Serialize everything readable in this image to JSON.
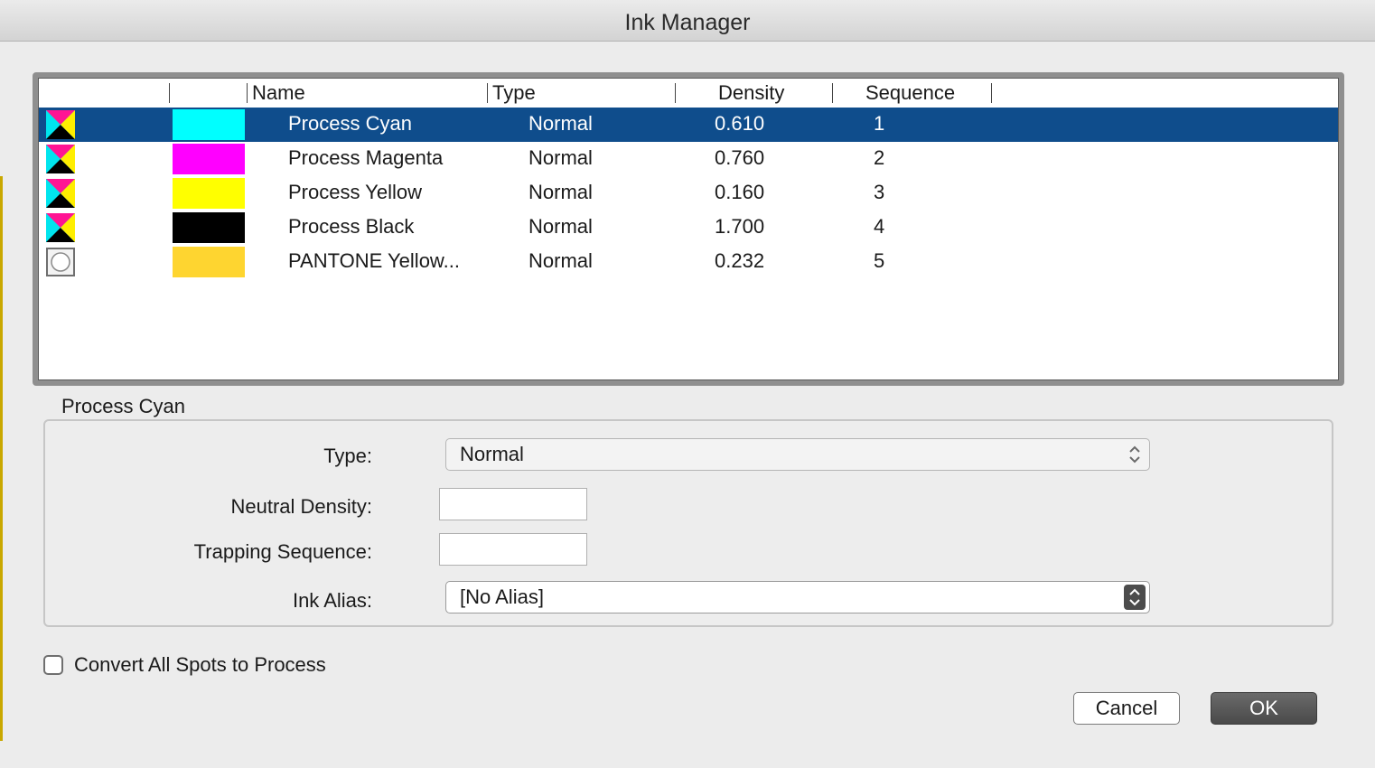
{
  "window": {
    "title": "Ink Manager"
  },
  "list": {
    "columns": {
      "name": "Name",
      "type": "Type",
      "density": "Density",
      "sequence": "Sequence"
    },
    "rows": [
      {
        "icon": "process-ink-icon",
        "swatch_color": "#00ffff",
        "name": "Process Cyan",
        "type": "Normal",
        "density": "0.610",
        "sequence": "1",
        "selected": true
      },
      {
        "icon": "process-ink-icon",
        "swatch_color": "#ff00ff",
        "name": "Process Magenta",
        "type": "Normal",
        "density": "0.760",
        "sequence": "2",
        "selected": false
      },
      {
        "icon": "process-ink-icon",
        "swatch_color": "#ffff00",
        "name": "Process Yellow",
        "type": "Normal",
        "density": "0.160",
        "sequence": "3",
        "selected": false
      },
      {
        "icon": "process-ink-icon",
        "swatch_color": "#000000",
        "name": "Process Black",
        "type": "Normal",
        "density": "1.700",
        "sequence": "4",
        "selected": false
      },
      {
        "icon": "spot-ink-icon",
        "swatch_color": "#fed530",
        "name": "PANTONE Yellow...",
        "type": "Normal",
        "density": "0.232",
        "sequence": "5",
        "selected": false
      }
    ]
  },
  "details": {
    "group_title": "Process Cyan",
    "type_label": "Type:",
    "type_value": "Normal",
    "neutral_density_label": "Neutral Density:",
    "neutral_density_value": "",
    "trapping_sequence_label": "Trapping Sequence:",
    "trapping_sequence_value": "",
    "ink_alias_label": "Ink Alias:",
    "ink_alias_value": "[No Alias]"
  },
  "convert_all_spots": {
    "label": "Convert All Spots to Process",
    "checked": false
  },
  "buttons": {
    "cancel": "Cancel",
    "ok": "OK"
  },
  "colors": {
    "selection": "#0f4d8c",
    "ok_button": "#555555"
  }
}
